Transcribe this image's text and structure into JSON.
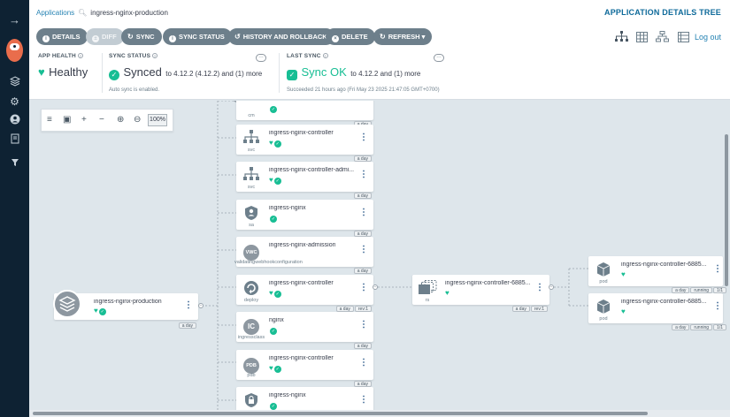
{
  "breadcrumb": {
    "root": "Applications",
    "current": "ingress-nginx-production"
  },
  "page_title": "APPLICATION DETAILS TREE",
  "toolbar": {
    "details": "DETAILS",
    "diff": "DIFF",
    "sync": "SYNC",
    "sync_status": "SYNC STATUS",
    "history": "HISTORY AND ROLLBACK",
    "delete": "DELETE",
    "refresh": "REFRESH"
  },
  "logout": "Log out",
  "app_health": {
    "label": "APP HEALTH",
    "value": "Healthy"
  },
  "sync_status": {
    "label": "SYNC STATUS",
    "value": "Synced",
    "detail": "to 4.12.2 (4.12.2) and (1) more",
    "note": "Auto sync is enabled."
  },
  "last_sync": {
    "label": "LAST SYNC",
    "value": "Sync OK",
    "detail": "to 4.12.2 and (1) more",
    "note": "Succeeded 21 hours ago (Fri May 23 2025 21:47:05 GMT+0700)"
  },
  "zoom": {
    "level": "100%"
  },
  "app_node": {
    "name": "ingress-nginx-production",
    "age": "a day"
  },
  "nodes": [
    {
      "name": "",
      "kind": "cm",
      "age": "a day"
    },
    {
      "name": "ingress-nginx-controller",
      "kind": "svc",
      "age": "a day"
    },
    {
      "name": "ingress-nginx-controller-admi...",
      "kind": "svc",
      "age": "a day"
    },
    {
      "name": "ingress-nginx",
      "kind": "sa",
      "age": "a day"
    },
    {
      "name": "ingress-nginx-admission",
      "kind": "validatingwebhookconfiguration",
      "icon_text": "VWC",
      "age": "a day"
    },
    {
      "name": "ingress-nginx-controller",
      "kind": "deploy",
      "age": "a day",
      "rev": "rev:1"
    },
    {
      "name": "nginx",
      "kind": "ingressclass",
      "icon_text": "IC",
      "age": "a day"
    },
    {
      "name": "ingress-nginx-controller",
      "kind": "pdb",
      "icon_text": "PDB",
      "age": "a day"
    },
    {
      "name": "ingress-nginx",
      "kind": "",
      "age": ""
    }
  ],
  "rs_node": {
    "name": "ingress-nginx-controller-6885...",
    "kind": "rs",
    "age": "a day",
    "rev": "rev:1"
  },
  "pods": [
    {
      "name": "ingress-nginx-controller-6885...",
      "kind": "pod",
      "age": "a day",
      "state": "running",
      "ready": "1/1"
    },
    {
      "name": "ingress-nginx-controller-6885...",
      "kind": "pod",
      "age": "a day",
      "state": "running",
      "ready": "1/1"
    }
  ]
}
